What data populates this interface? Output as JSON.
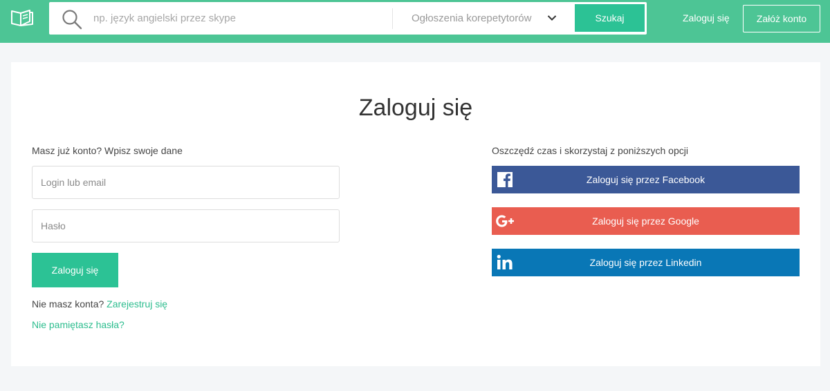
{
  "header": {
    "logo_icon": "open-book-icon",
    "search": {
      "placeholder": "np. język angielski przez skype",
      "value": "",
      "icon": "search-icon"
    },
    "category": {
      "selected": "Ogłoszenia korepetytorów",
      "icon": "chevron-down-icon"
    },
    "search_button": "Szukaj",
    "login_link": "Zaloguj się",
    "register_button": "Załóż konto"
  },
  "main": {
    "title": "Zaloguj się",
    "left": {
      "intro": "Masz już konto? Wpisz swoje dane",
      "login_placeholder": "Login lub email",
      "password_placeholder": "Hasło",
      "submit": "Zaloguj się",
      "no_account_text": "Nie masz konta?",
      "register_link": "Zarejestruj się",
      "forgot_link": "Nie pamiętasz hasła?"
    },
    "right": {
      "intro": "Oszczędź czas i skorzystaj z poniższych opcji",
      "social": [
        {
          "label": "Zaloguj się przez Facebook",
          "icon": "facebook-icon",
          "color": "#3b5897"
        },
        {
          "label": "Zaloguj się przez Google",
          "icon": "google-plus-icon",
          "color": "#e95d50"
        },
        {
          "label": "Zaloguj się przez Linkedin",
          "icon": "linkedin-icon",
          "color": "#0977b6"
        }
      ]
    }
  },
  "colors": {
    "header": "#4dc595",
    "accent": "#2cc295",
    "link": "#2cbd8e",
    "background": "#f4f6f8"
  }
}
